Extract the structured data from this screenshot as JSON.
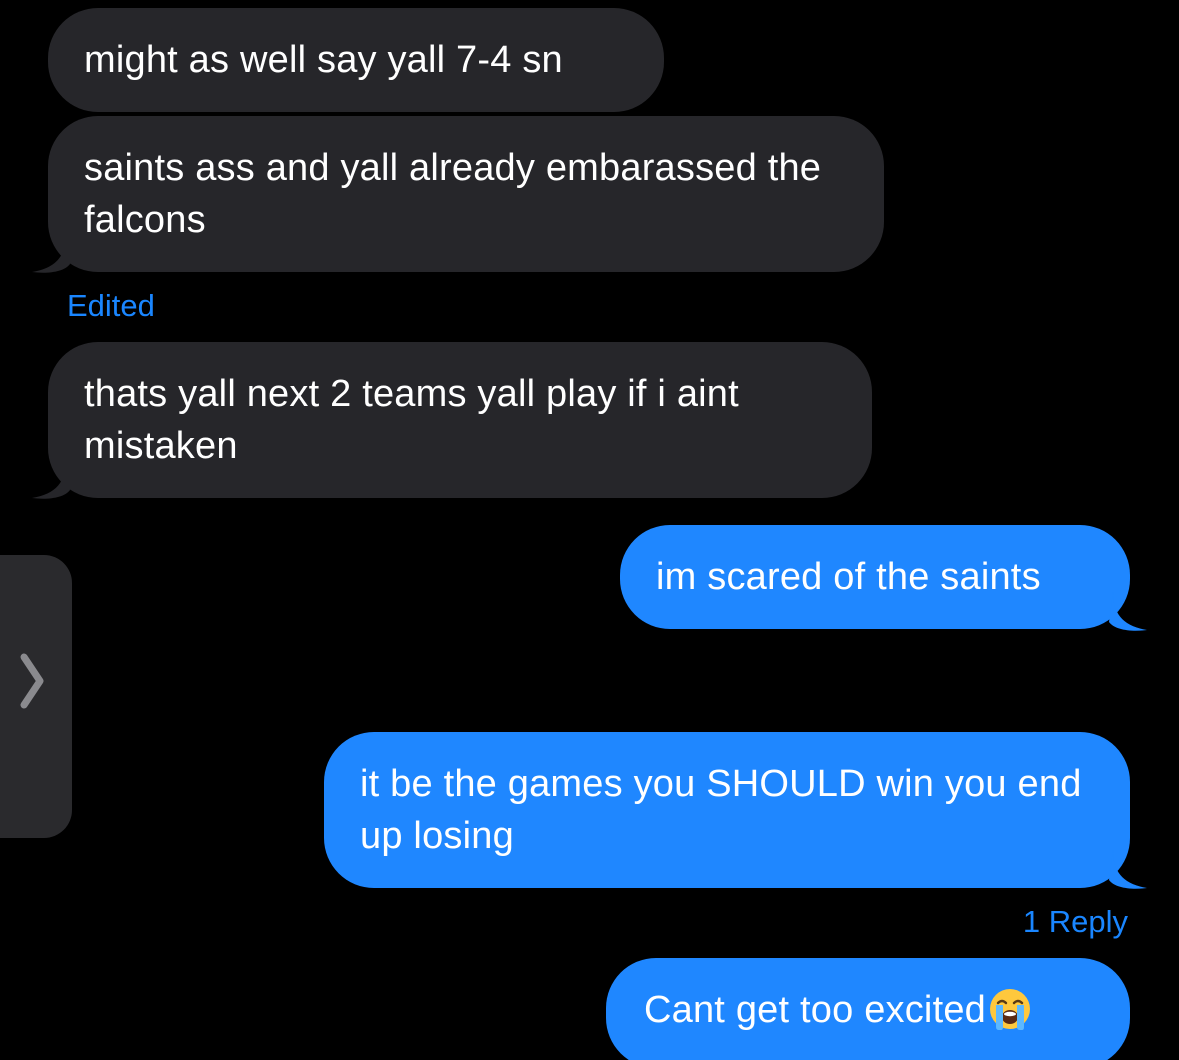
{
  "messages": [
    {
      "id": "m1",
      "direction": "incoming",
      "text": "might as well say yall 7-4 sn"
    },
    {
      "id": "m2",
      "direction": "incoming",
      "text": "saints ass and yall already embarassed the falcons"
    },
    {
      "id": "m3",
      "direction": "incoming",
      "text": "thats yall next 2 teams yall play if i aint mistaken"
    },
    {
      "id": "m4",
      "direction": "outgoing",
      "text": "im scared of the saints"
    },
    {
      "id": "m5",
      "direction": "outgoing",
      "text": "it be the games you SHOULD win you end up losing"
    },
    {
      "id": "m6",
      "direction": "outgoing",
      "text": "Cant get too excited",
      "emoji": "loudly-crying-face"
    }
  ],
  "edited_label": "Edited",
  "reply_count_label": "1 Reply",
  "side_panel": {
    "icon": "chevron-right-icon"
  },
  "colors": {
    "background": "#000000",
    "incoming_bubble": "#26262a",
    "outgoing_bubble": "#1f87ff",
    "meta_text": "#1a86ff",
    "text": "#ffffff"
  }
}
